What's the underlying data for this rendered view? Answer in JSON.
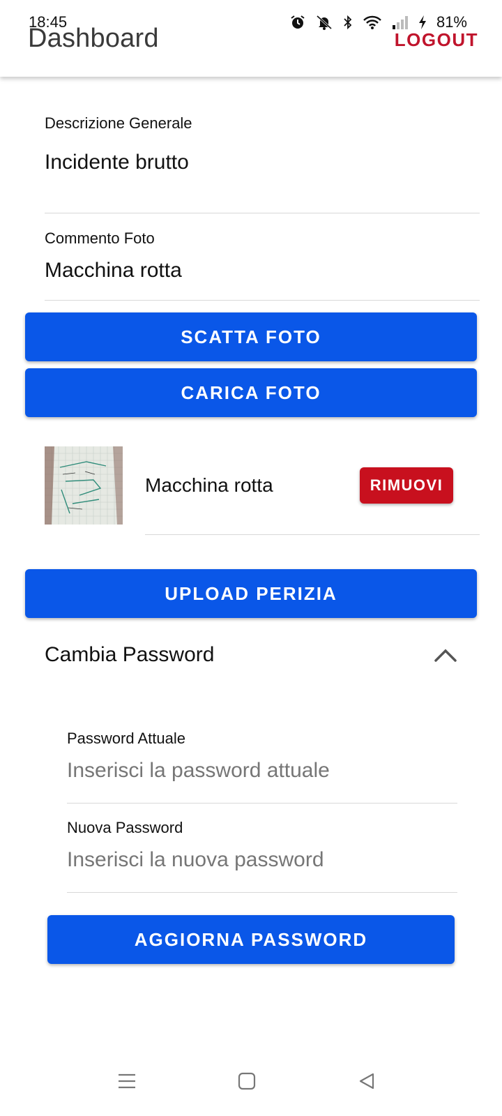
{
  "status_bar": {
    "time": "18:45",
    "battery": "81%",
    "icons": [
      "alarm-icon",
      "muted-bell-icon",
      "bluetooth-icon",
      "wifi-icon",
      "signal-icon",
      "charging-icon"
    ]
  },
  "header": {
    "title": "Dashboard",
    "logout_label": "LOGOUT"
  },
  "form": {
    "description_label": "Descrizione Generale",
    "description_value": "Incidente brutto",
    "photo_comment_label": "Commento Foto",
    "photo_comment_value": "Macchina rotta",
    "take_photo_label": "SCATTA FOTO",
    "upload_photo_label": "CARICA FOTO"
  },
  "photos": [
    {
      "caption": "Macchina rotta",
      "remove_label": "RIMUOVI"
    }
  ],
  "upload_label": "UPLOAD PERIZIA",
  "change_password": {
    "title": "Cambia Password",
    "current_label": "Password Attuale",
    "current_placeholder": "Inserisci la password attuale",
    "new_label": "Nuova Password",
    "new_placeholder": "Inserisci la nuova password",
    "submit_label": "AGGIORNA PASSWORD"
  },
  "colors": {
    "primary": "#0a57e8",
    "danger": "#c8101e",
    "logout": "#c0142c"
  }
}
